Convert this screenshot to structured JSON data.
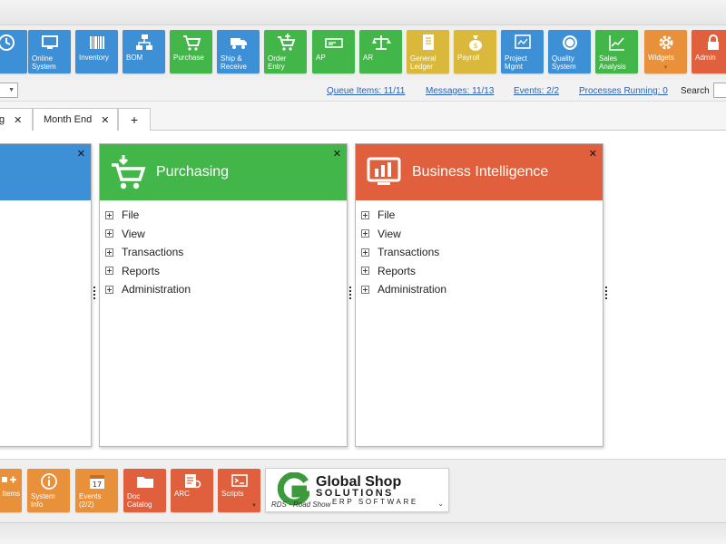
{
  "ribbon": {
    "tiles": [
      {
        "label": "",
        "icon": "clock-icon",
        "color": "#3d8fd6"
      },
      {
        "label": "Online\nSystem",
        "icon": "monitor-icon",
        "color": "#3d8fd6"
      },
      {
        "label": "Inventory",
        "icon": "barcode-icon",
        "color": "#3d8fd6"
      },
      {
        "label": "BOM",
        "icon": "hierarchy-icon",
        "color": "#3d8fd6"
      },
      {
        "label": "Purchase",
        "icon": "cart-icon",
        "color": "#43b649"
      },
      {
        "label": "Ship &\nReceive",
        "icon": "truck-icon",
        "color": "#3d8fd6"
      },
      {
        "label": "Order\nEntry",
        "icon": "cart-plus-icon",
        "color": "#43b649"
      },
      {
        "label": "AP",
        "icon": "check-payment-icon",
        "color": "#43b649"
      },
      {
        "label": "AR",
        "icon": "scale-icon",
        "color": "#43b649"
      },
      {
        "label": "General\nLedger",
        "icon": "ledger-book-icon",
        "color": "#d9b83b"
      },
      {
        "label": "Payroll",
        "icon": "money-bag-icon",
        "color": "#d9b83b"
      },
      {
        "label": "Project\nMgmt",
        "icon": "project-board-icon",
        "color": "#3d8fd6"
      },
      {
        "label": "Quality\nSystem",
        "icon": "quality-seal-icon",
        "color": "#3d8fd6"
      },
      {
        "label": "Sales\nAnalysis",
        "icon": "line-chart-icon",
        "color": "#43b649"
      },
      {
        "label": "Widgets",
        "icon": "gear-icon",
        "color": "#e8913a"
      },
      {
        "label": "Admin",
        "icon": "lock-icon",
        "color": "#e0603d"
      }
    ]
  },
  "toolbar": {
    "queue_items": "Queue Items: 11/11",
    "messages": "Messages: 11/13",
    "events": "Events: 2/2",
    "processes": "Processes Running: 0",
    "search_label": "Search"
  },
  "tabs": [
    {
      "label": "g"
    },
    {
      "label": "Month End"
    }
  ],
  "tab_close": "✕",
  "tab_add": "+",
  "panels": [
    {
      "title": "",
      "color": "#3d8fd6",
      "items": []
    },
    {
      "title": "Purchasing",
      "color": "#43b649",
      "icon": "cart-icon",
      "items": [
        "File",
        "View",
        "Transactions",
        "Reports",
        "Administration"
      ]
    },
    {
      "title": "Business Intelligence",
      "color": "#e0603d",
      "icon": "dashboard-monitor-icon",
      "items": [
        "File",
        "View",
        "Transactions",
        "Reports",
        "Administration"
      ]
    }
  ],
  "panel_close": "✕",
  "dock": {
    "tiles": [
      {
        "label": "Items",
        "icon": "items-icon",
        "color": "#e8913a"
      },
      {
        "label": "System\nInfo",
        "icon": "info-icon",
        "color": "#e8913a"
      },
      {
        "label": "Events\n(2/2)",
        "icon": "calendar-icon",
        "color": "#e8913a",
        "badge": "17"
      },
      {
        "label": "Doc\nCatalog",
        "icon": "folder-icon",
        "color": "#e0603d"
      },
      {
        "label": "ARC",
        "icon": "report-icon",
        "color": "#e0603d"
      },
      {
        "label": "Scripts",
        "icon": "script-icon",
        "color": "#e0603d"
      }
    ],
    "logo": {
      "line1": "Global Shop",
      "line2": "SOLUTIONS",
      "line3": "ERP SOFTWARE",
      "caption": "RDS - Road Show"
    }
  }
}
